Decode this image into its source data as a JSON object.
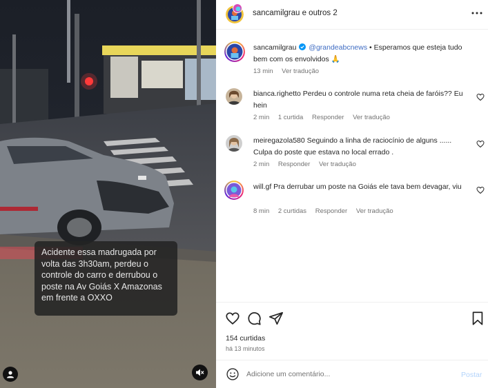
{
  "media": {
    "caption": "Acidente essa madrugada por volta das 3h30am, perdeu o controle do carro e derrubou o poste na Av Goiás X Amazonas em frente a OXXO"
  },
  "header": {
    "title": "sancamilgrau e outros 2"
  },
  "post": {
    "username": "sancamilgrau",
    "mention": "@grandeabcnews",
    "text": " • Esperamos que esteja tudo bem com os envolvidos 🙏",
    "time": "13 min",
    "see_translation": "Ver tradução"
  },
  "comments": [
    {
      "username": "bianca.righetto",
      "text": " Perdeu o controle numa reta cheia de faróis?? Eu hein",
      "time": "2 min",
      "likes": "1 curtida",
      "reply": "Responder",
      "translate": "Ver tradução"
    },
    {
      "username": "meiregazola580",
      "text": " Seguindo a linha de raciocínio de alguns ...... Culpa do poste que estava no local errado .",
      "time": "2 min",
      "likes": "",
      "reply": "Responder",
      "translate": "Ver tradução"
    },
    {
      "username": "will.gf",
      "text": " Pra derrubar um poste na Goiás ele tava bem devagar, viu",
      "time": "8 min",
      "likes": "2 curtidas",
      "reply": "Responder",
      "translate": "Ver tradução"
    }
  ],
  "footer": {
    "likes": "154 curtidas",
    "time": "há 13 minutos",
    "comment_placeholder": "Adicione um comentário...",
    "post_label": "Postar"
  },
  "colors": {
    "link": "#3d6bc2",
    "muted": "#737373",
    "post_disabled": "#b3d4fb",
    "verified": "#0095f6"
  }
}
